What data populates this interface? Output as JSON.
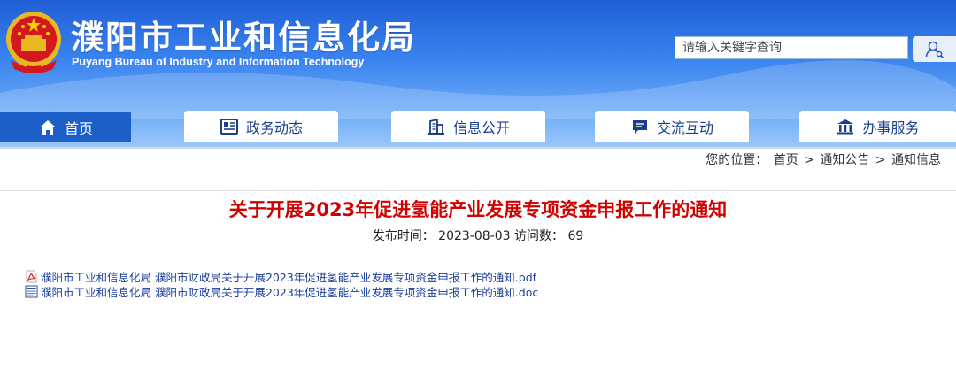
{
  "header": {
    "title": "濮阳市工业和信息化局",
    "subtitle": "Puyang Bureau of Industry and Information Technology",
    "search_placeholder": "请输入关键字查询",
    "search_icon": "user-search-icon"
  },
  "nav": {
    "tabs": [
      {
        "label": "首页",
        "icon": "home-icon"
      },
      {
        "label": "政务动态",
        "icon": "newspaper-icon"
      },
      {
        "label": "信息公开",
        "icon": "building-doc-icon"
      },
      {
        "label": "交流互动",
        "icon": "chat-icon"
      },
      {
        "label": "办事服务",
        "icon": "government-building-icon"
      }
    ]
  },
  "breadcrumb": {
    "prefix": "您的位置：",
    "items": [
      "首页",
      "通知公告",
      "通知信息"
    ],
    "separator": ">"
  },
  "article": {
    "title": "关于开展2023年促进氢能产业发展专项资金申报工作的通知",
    "publish_label": "发布时间：",
    "publish_date": "2023-08-03",
    "visits_label": "访问数：",
    "visits": "69",
    "attachments": [
      {
        "name": "濮阳市工业和信息化局 濮阳市财政局关于开展2023年促进氢能产业发展专项资金申报工作的通知.pdf",
        "icon": "pdf-file-icon"
      },
      {
        "name": "濮阳市工业和信息化局 濮阳市财政局关于开展2023年促进氢能产业发展专项资金申报工作的通知.doc",
        "icon": "word-file-icon"
      }
    ]
  },
  "colors": {
    "header_blue": "#2f73e6",
    "nav_active": "#1d5fc8",
    "title_red": "#d10000",
    "link_blue": "#1a3f9a"
  }
}
